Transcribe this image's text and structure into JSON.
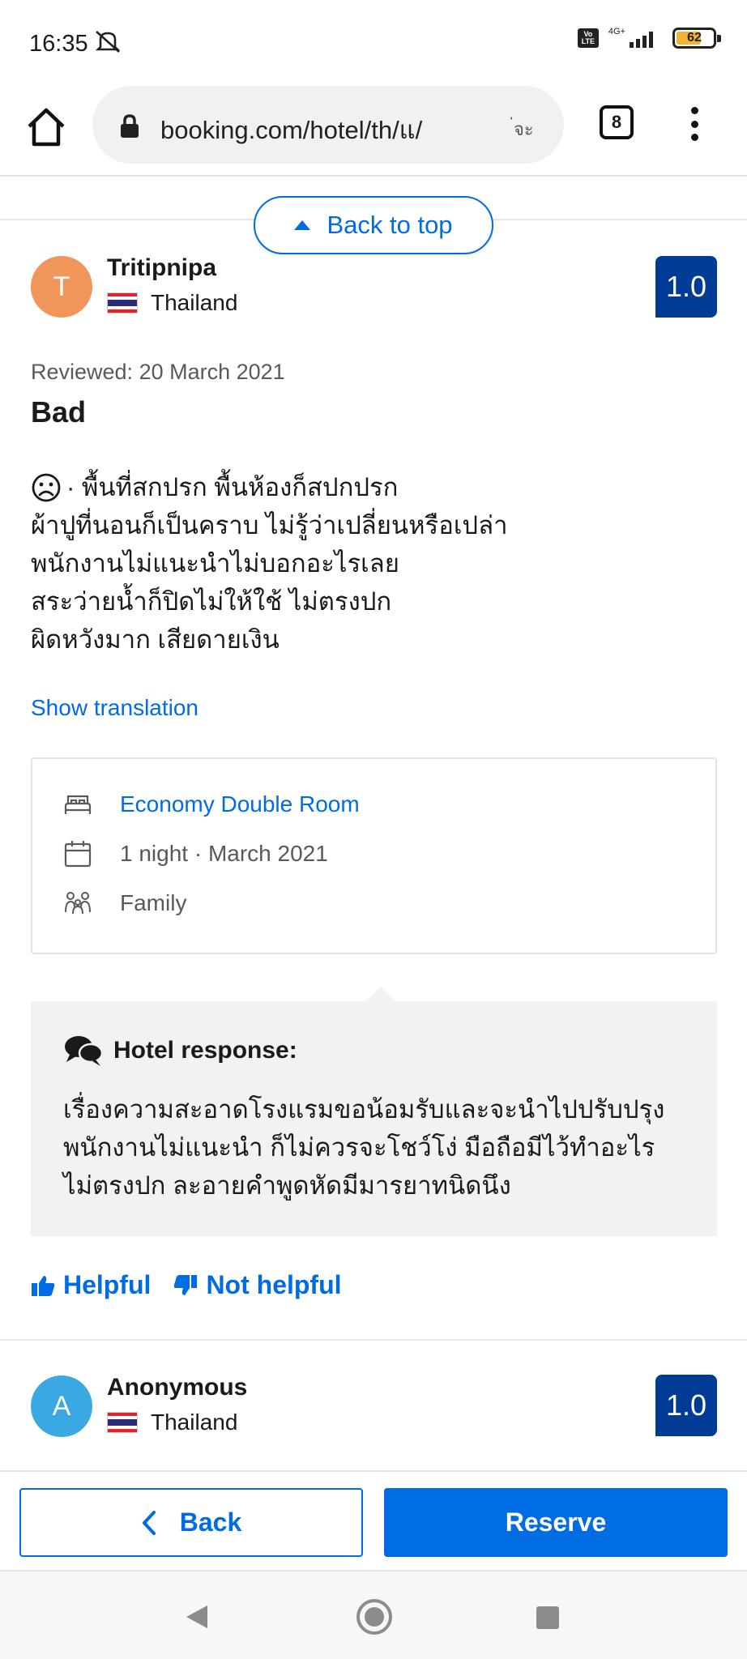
{
  "status_bar": {
    "time": "16:35",
    "network": "4G+",
    "battery": "62",
    "battery_level": 0.62
  },
  "browser": {
    "url": "booking.com/hotel/th/แ/",
    "url_tail": "่จะ",
    "tab_count": "8"
  },
  "back_to_top": {
    "label": "Back to top"
  },
  "reviews": [
    {
      "avatar_letter": "T",
      "avatar_color": "#f0965a",
      "name": "Tritipnipa",
      "country": "Thailand",
      "score": "1.0",
      "reviewed_date": "Reviewed: 20 March 2021",
      "title": "Bad",
      "body_lines": [
        "· พื้นที่สกปรก พื้นห้องก็สปกปรก",
        "ผ้าปูที่นอนก็เป็นคราบ ไม่รู้ว่าเปลี่ยนหรือเปล่า",
        "พนักงานไม่แนะนำไม่บอกอะไรเลย",
        "สระว่ายน้ำก็ปิดไม่ให้ใช้ ไม่ตรงปก",
        "ผิดหวังมาก เสียดายเงิน"
      ],
      "show_translation": "Show translation",
      "stay": {
        "room": "Economy Double Room",
        "nights": "1 night · March 2021",
        "traveler_type": "Family"
      },
      "hotel_response": {
        "heading": "Hotel response:",
        "lines": [
          "เรื่องความสะอาดโรงแรมขอน้อมรับและจะนำไปปรับปรุง",
          "พนักงานไม่แนะนำ ก็ไม่ควรจะโชว์โง่ มือถือมีไว้ทำอะไร",
          "ไม่ตรงปก ละอายคำพูดหัดมีมารยาทนิดนึง"
        ]
      },
      "helpful": "Helpful",
      "not_helpful": "Not helpful"
    },
    {
      "avatar_letter": "A",
      "avatar_color": "#3aa8e3",
      "name": "Anonymous",
      "country": "Thailand",
      "score": "1.0"
    }
  ],
  "actions": {
    "back": "Back",
    "reserve": "Reserve"
  },
  "colors": {
    "accent": "#006ce4",
    "score_bg": "#003b95"
  }
}
